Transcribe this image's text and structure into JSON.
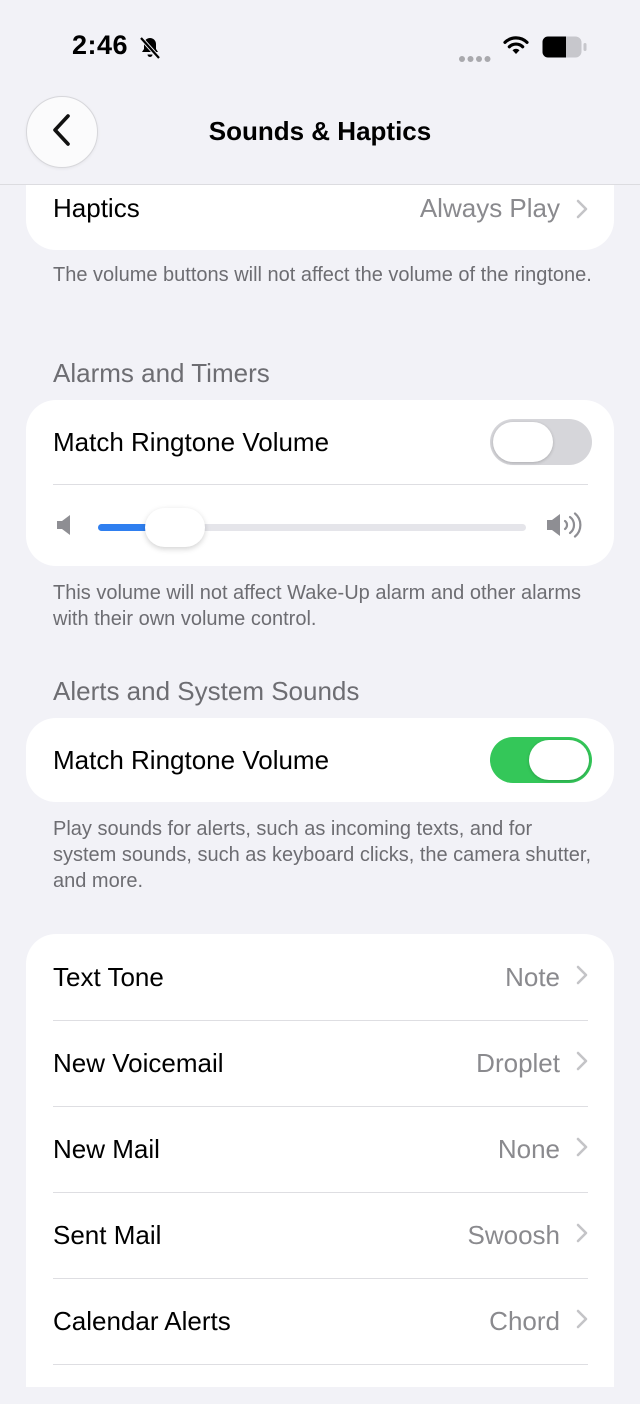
{
  "status_bar": {
    "time": "2:46",
    "icons": [
      "bell-slash-icon",
      "cellular-dots-icon",
      "wifi-icon",
      "battery-icon"
    ]
  },
  "nav": {
    "title": "Sounds & Haptics",
    "back_icon": "chevron-left-icon"
  },
  "haptics": {
    "label": "Haptics",
    "value": "Always Play"
  },
  "ringtone_footnote": "The volume buttons will not affect the volume of the ringtone.",
  "alarms": {
    "header": "Alarms and Timers",
    "match_label": "Match Ringtone Volume",
    "match_on": false,
    "volume_level": 0.18,
    "footnote": "This volume will not affect Wake-Up alarm and other alarms with their own volume control."
  },
  "alerts": {
    "header": "Alerts and System Sounds",
    "match_label": "Match Ringtone Volume",
    "match_on": true,
    "footnote": "Play sounds for alerts, such as incoming texts, and for system sounds, such as keyboard clicks, the camera shutter, and more."
  },
  "tones": [
    {
      "label": "Text Tone",
      "value": "Note"
    },
    {
      "label": "New Voicemail",
      "value": "Droplet"
    },
    {
      "label": "New Mail",
      "value": "None"
    },
    {
      "label": "Sent Mail",
      "value": "Swoosh"
    },
    {
      "label": "Calendar Alerts",
      "value": "Chord"
    }
  ],
  "colors": {
    "accent": "#2f7ff0",
    "toggle_on": "#34c759",
    "background": "#f2f2f7"
  }
}
